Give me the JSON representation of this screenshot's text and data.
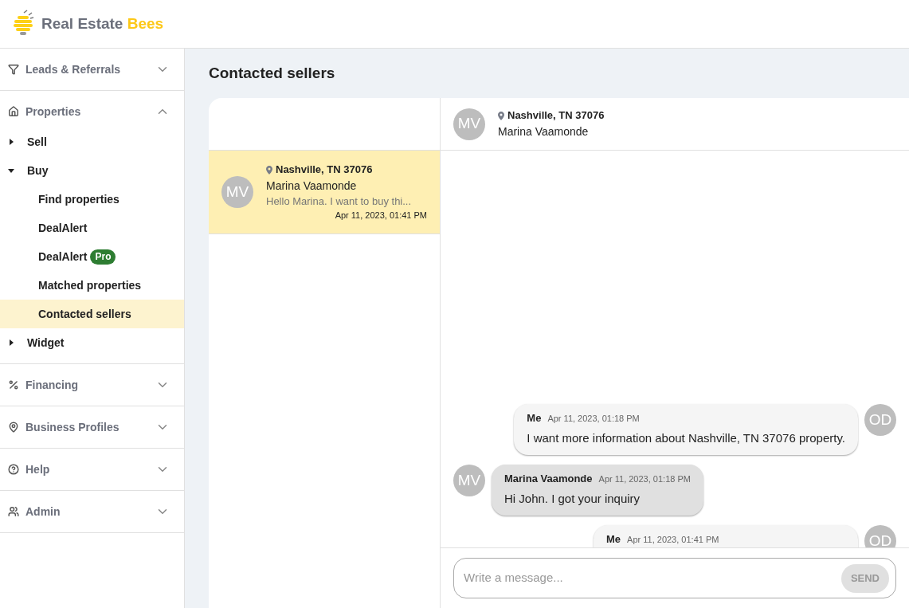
{
  "logo": {
    "text": "Real Estate",
    "accent": "Bees"
  },
  "sidebar": {
    "sections": [
      {
        "label": "Leads & Referrals",
        "expanded": false
      },
      {
        "label": "Properties",
        "expanded": true,
        "children": [
          {
            "label": "Sell",
            "expanded": false
          },
          {
            "label": "Buy",
            "expanded": true,
            "children": [
              {
                "label": "Find properties",
                "selected": false
              },
              {
                "label": "DealAlert",
                "selected": false
              },
              {
                "label": "DealAlert",
                "badge": "Pro",
                "selected": false
              },
              {
                "label": "Matched properties",
                "selected": false
              },
              {
                "label": "Contacted sellers",
                "selected": true
              }
            ]
          },
          {
            "label": "Widget",
            "expanded": false
          }
        ]
      },
      {
        "label": "Financing",
        "expanded": false
      },
      {
        "label": "Business Profiles",
        "expanded": false
      },
      {
        "label": "Help",
        "expanded": false
      },
      {
        "label": "Admin",
        "expanded": false
      }
    ]
  },
  "page_title": "Contacted sellers",
  "conversations": [
    {
      "initials": "MV",
      "location": "Nashville, TN 37076",
      "name": "Marina Vaamonde",
      "preview": "Hello Marina. I want to buy thi...",
      "time": "Apr 11, 2023, 01:41 PM",
      "selected": true
    }
  ],
  "chat_header": {
    "initials": "MV",
    "location": "Nashville, TN 37076",
    "name": "Marina Vaamonde"
  },
  "messages": [
    {
      "kind": "own",
      "initials": "OD",
      "sender": "Me",
      "time": "Apr 11, 2023, 01:18 PM",
      "text": "I want more information about Nashville, TN 37076 property."
    },
    {
      "kind": "other",
      "initials": "MV",
      "sender": "Marina Vaamonde",
      "time": "Apr 11, 2023, 01:18 PM",
      "text": "Hi John. I got your inquiry"
    },
    {
      "kind": "own",
      "initials": "OD",
      "sender": "Me",
      "time": "Apr 11, 2023, 01:41 PM"
    }
  ],
  "composer": {
    "placeholder": "Write a message...",
    "send": "SEND"
  }
}
